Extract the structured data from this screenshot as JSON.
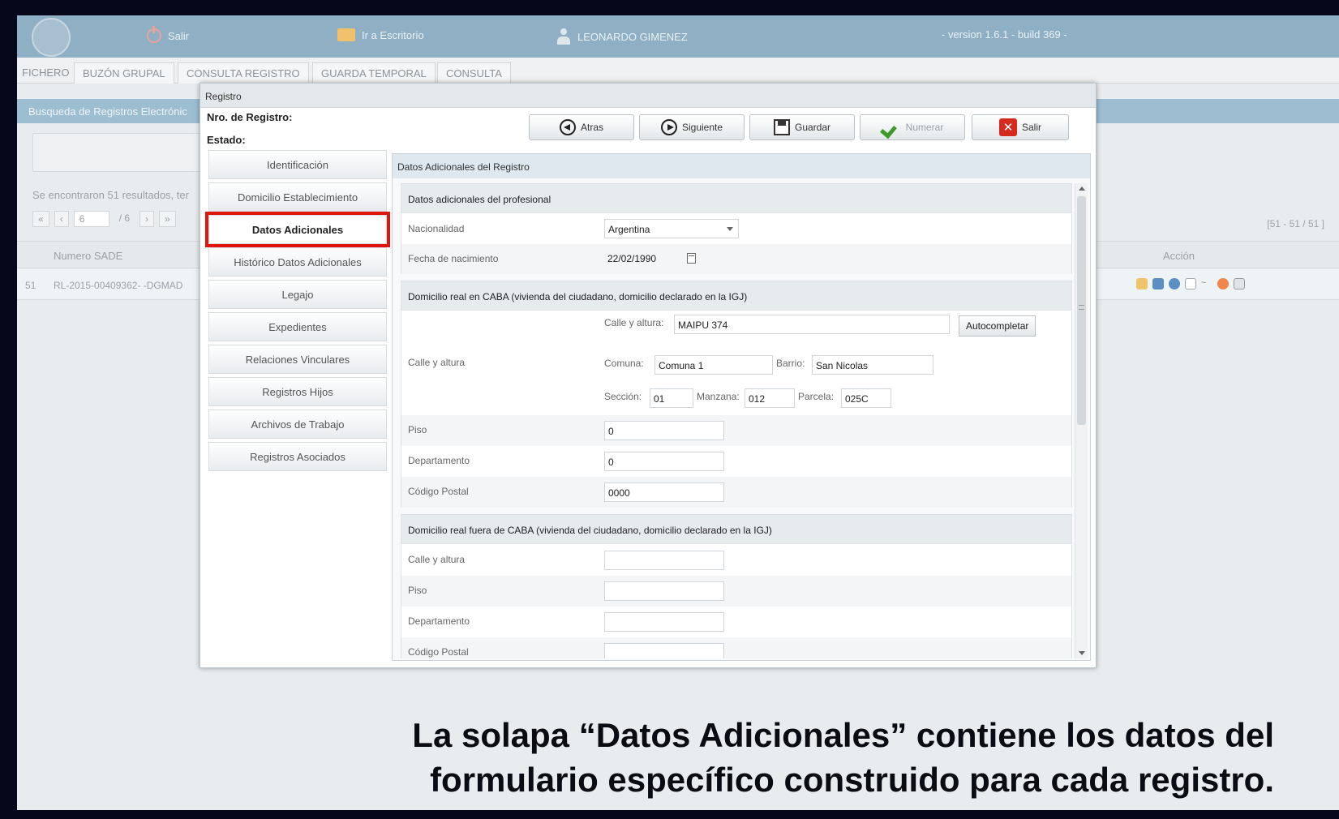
{
  "topbar": {
    "salir": "Salir",
    "escritorio": "Ir a Escritorio",
    "user": "LEONARDO GIMENEZ",
    "version": "- version 1.6.1 - build 369 -"
  },
  "tabs": [
    "FICHERO",
    "BUZÓN GRUPAL",
    "CONSULTA REGISTRO",
    "GUARDA TEMPORAL",
    "CONSULTA"
  ],
  "background": {
    "header": "Busqueda de Registros Electrónic",
    "results": "Se encontraron 51 resultados, ter",
    "page_value": "6",
    "page_total": "/ 6",
    "count": "[51 - 51 / 51 ]",
    "col_numero": "Numero SADE",
    "col_accion": "Acción",
    "row_index": "51",
    "row_numero": "RL-2015-00409362- -DGMAD"
  },
  "modal": {
    "title": "Registro",
    "nro_label": "Nro. de Registro:",
    "estado_label": "Estado:",
    "buttons": {
      "atras": "Atras",
      "siguiente": "Siguiente",
      "guardar": "Guardar",
      "numerar": "Numerar",
      "salir": "Salir"
    },
    "nav": [
      "Identificación",
      "Domicilio Establecimiento",
      "Datos Adicionales",
      "Histórico Datos Adicionales",
      "Legajo",
      "Expedientes",
      "Relaciones Vinculares",
      "Registros Hijos",
      "Archivos de Trabajo",
      "Registros Asociados"
    ],
    "content_title": "Datos Adicionales del Registro",
    "sec1": {
      "title": "Datos adicionales del profesional",
      "nacionalidad_label": "Nacionalidad",
      "nacionalidad_value": "Argentina",
      "fecha_label": "Fecha de nacimiento",
      "fecha_value": "22/02/1990"
    },
    "sec2": {
      "title": "Domicilio real en CABA (vivienda del ciudadano, domicilio declarado en la IGJ)",
      "calle_label": "Calle y altura",
      "calle_sub": "Calle y altura:",
      "calle_value": "MAIPU 374",
      "autocompletar": "Autocompletar",
      "comuna_label": "Comuna:",
      "comuna_value": "Comuna 1",
      "barrio_label": "Barrio:",
      "barrio_value": "San Nicolas",
      "seccion_label": "Sección:",
      "seccion_value": "01",
      "manzana_label": "Manzana:",
      "manzana_value": "012",
      "parcela_label": "Parcela:",
      "parcela_value": "025C",
      "piso_label": "Piso",
      "piso_value": "0",
      "depto_label": "Departamento",
      "depto_value": "0",
      "cp_label": "Código Postal",
      "cp_value": "0000"
    },
    "sec3": {
      "title": "Domicilio real fuera de CABA (vivienda del ciudadano, domicilio declarado en la IGJ)",
      "calle_label": "Calle y altura",
      "piso_label": "Piso",
      "depto_label": "Departamento",
      "cp_label": "Código Postal"
    }
  },
  "caption": {
    "line1": "La solapa “Datos Adicionales” contiene los datos del",
    "line2": "formulario específico construido para cada registro."
  }
}
